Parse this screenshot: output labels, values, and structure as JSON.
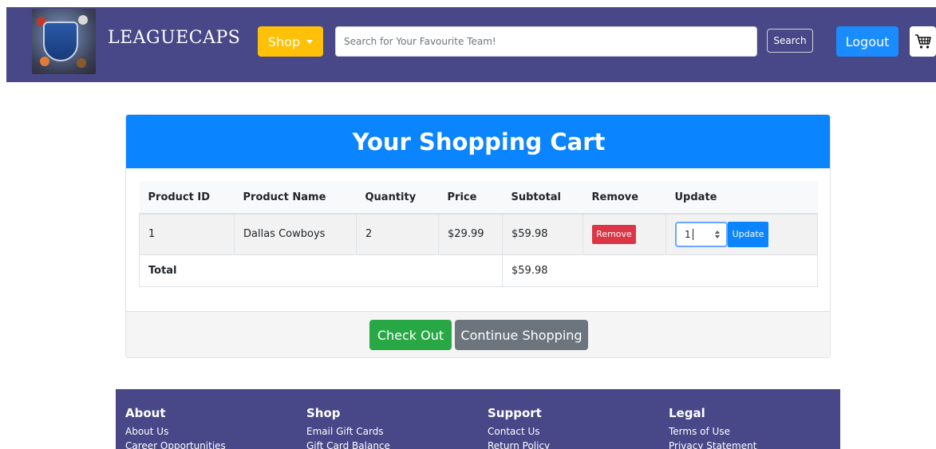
{
  "header": {
    "brand": "LEAGUECAPS",
    "shop_label": "Shop",
    "search_placeholder": "Search for Your Favourite Team!",
    "search_label": "Search",
    "logout_label": "Logout"
  },
  "cart": {
    "title": "Your Shopping Cart",
    "columns": [
      "Product ID",
      "Product Name",
      "Quantity",
      "Price",
      "Subtotal",
      "Remove",
      "Update"
    ],
    "items": [
      {
        "product_id": "1",
        "product_name": "Dallas Cowboys",
        "quantity": "2",
        "price": "$29.99",
        "subtotal": "$59.98",
        "remove_label": "Remove",
        "update_value": "1",
        "update_label": "Update"
      }
    ],
    "total_label": "Total",
    "total_value": "$59.98",
    "checkout_label": "Check Out",
    "continue_label": "Continue Shopping"
  },
  "footer": {
    "columns": [
      {
        "title": "About",
        "links": [
          "About Us",
          "Career Opportunities"
        ]
      },
      {
        "title": "Shop",
        "links": [
          "Email Gift Cards",
          "Gift Card Balance"
        ]
      },
      {
        "title": "Support",
        "links": [
          "Contact Us",
          "Return Policy"
        ]
      },
      {
        "title": "Legal",
        "links": [
          "Terms of Use",
          "Privacy Statement"
        ]
      }
    ]
  },
  "colors": {
    "navbar": "#484788",
    "shop_button": "#ffc107",
    "primary": "#0a84ff",
    "danger": "#dc3545",
    "success": "#28a745",
    "secondary": "#6c757d"
  },
  "icons": {
    "logo": "leaguecaps-logo",
    "cart": "shopping-cart-icon",
    "shop_caret": "caret-down-icon"
  }
}
